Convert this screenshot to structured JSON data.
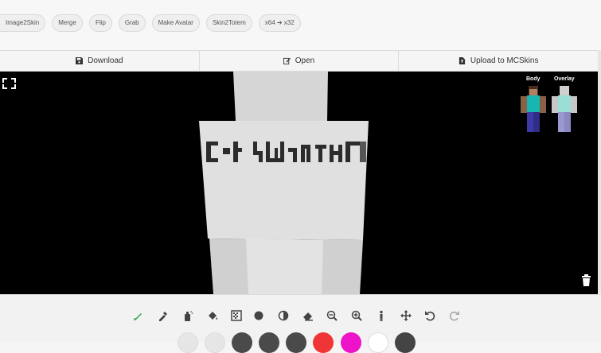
{
  "nav": {
    "chips": [
      "Image2Skin",
      "Merge",
      "Flip",
      "Grab",
      "Make Avatar",
      "Skin2Totem",
      "x64 ➔ x32"
    ]
  },
  "actions": {
    "download": "Download",
    "open": "Open",
    "upload": "Upload to MCSkins"
  },
  "preview": {
    "body_label": "Body",
    "overlay_label": "Overlay"
  },
  "canvas": {
    "skin_text": "COTSWORTH"
  },
  "tools": [
    "brush-icon",
    "pipette-icon",
    "spray-icon",
    "fill-bucket-icon",
    "dither-icon",
    "circle-icon",
    "contrast-icon",
    "eraser-icon",
    "zoom-out-icon",
    "zoom-in-icon",
    "figure-icon",
    "move-icon",
    "undo-icon",
    "redo-icon"
  ],
  "palette": [
    "#e6e6e6",
    "#e6e6e6",
    "#4a4a4a",
    "#4a4a4a",
    "#4a4a4a",
    "#ef3535",
    "#ee12c8",
    "#ffffff",
    "#444444"
  ],
  "colors": {
    "accent_green": "#2ea34a",
    "viewport_bg": "#000000"
  }
}
